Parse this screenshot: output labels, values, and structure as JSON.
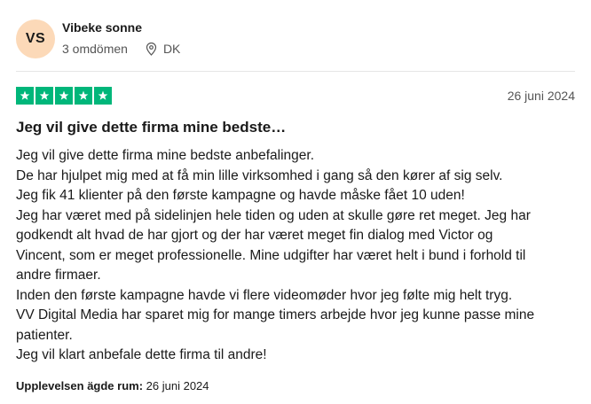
{
  "reviewer": {
    "initials": "VS",
    "name": "Vibeke sonne",
    "reviews_count": "3 omdömen",
    "country": "DK",
    "avatar_color": "#fcd9b8"
  },
  "rating": {
    "stars": 5,
    "max_stars": 5,
    "star_color": "#00b67a",
    "star_icon": "star-icon"
  },
  "review": {
    "date": "26 juni 2024",
    "title": "Jeg vil give dette firma mine bedste…",
    "body_lines": [
      "Jeg vil give dette firma mine bedste anbefalinger.",
      "De har hjulpet mig med at få min lille virksomhed i gang så den kører af sig selv.",
      "Jeg fik 41 klienter på den første kampagne og havde måske fået 10 uden!",
      "Jeg har været med på sidelinjen hele tiden og uden at skulle gøre ret meget. Jeg har",
      "godkendt alt hvad de har gjort og der har været meget fin dialog med Victor og",
      "Vincent, som er meget professionelle. Mine udgifter har været helt i bund i forhold til",
      "andre firmaer.",
      "Inden den første kampagne havde vi flere videomøder hvor jeg følte mig helt tryg.",
      "VV Digital Media har sparet mig for mange timers arbejde hvor jeg kunne passe mine",
      "patienter.",
      "Jeg vil klart anbefale dette firma til andre!"
    ],
    "experience_label": "Upplevelsen ägde rum:",
    "experience_date": "26 juni 2024"
  }
}
